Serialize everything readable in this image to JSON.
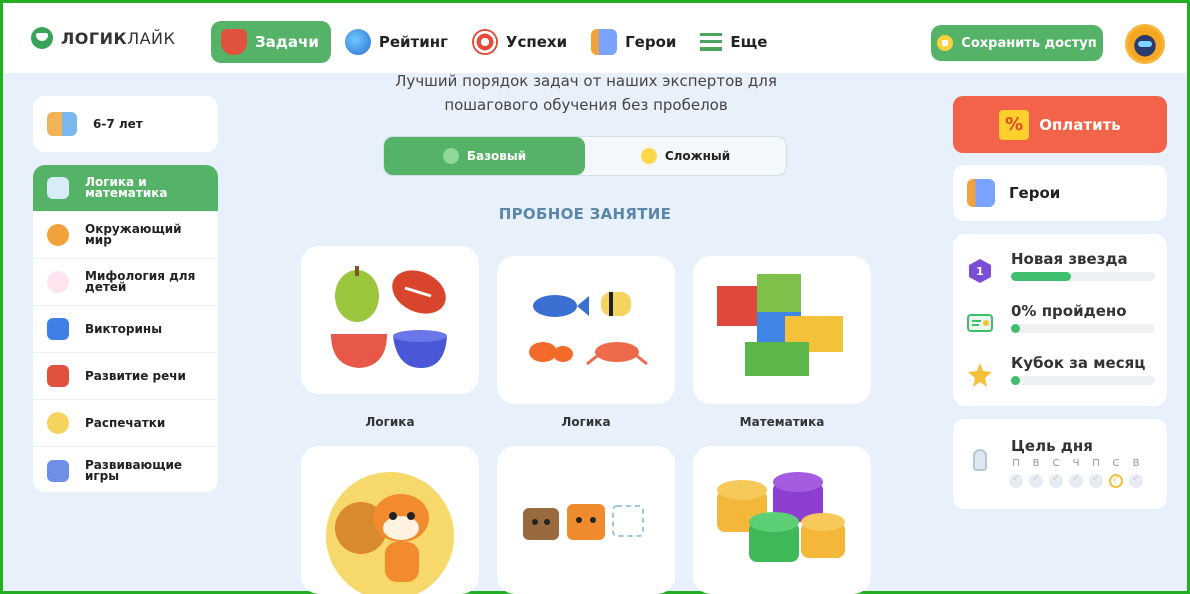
{
  "header": {
    "logo_bold": "ЛОГИК",
    "logo_light": "ЛАЙК",
    "nav": [
      {
        "label": "Задачи",
        "icon": "graduation-cap-icon"
      },
      {
        "label": "Рейтинг",
        "icon": "globe-icon"
      },
      {
        "label": "Успехи",
        "icon": "target-icon"
      },
      {
        "label": "Герои",
        "icon": "robot-hero-icon"
      },
      {
        "label": "Еще",
        "icon": "menu-icon"
      }
    ],
    "save_label": "Сохранить доступ"
  },
  "intro": {
    "line1": "Лучший порядок задач от наших экспертов для",
    "line2": "пошагового обучения без пробелов"
  },
  "level_toggle": {
    "basic": "Базовый",
    "hard": "Сложный",
    "selected": "basic"
  },
  "section_title": "ПРОБНОЕ ЗАНЯТИЕ",
  "age": "6-7 лет",
  "subjects": [
    {
      "line1": "Логика и",
      "line2": "математика"
    },
    {
      "line1": "Окружающий",
      "line2": "мир"
    },
    {
      "line1": "Мифология для",
      "line2": "детей"
    },
    {
      "line1": "Викторины",
      "line2": ""
    },
    {
      "line1": "Развитие речи",
      "line2": ""
    },
    {
      "line1": "Распечатки",
      "line2": ""
    },
    {
      "line1": "Развивающие",
      "line2": "игры"
    }
  ],
  "cards": [
    {
      "label": "Логика",
      "image": "fruits-and-cups"
    },
    {
      "label": "Логика",
      "image": "fish-and-crab"
    },
    {
      "label": "Математика",
      "image": "lego-bricks"
    },
    {
      "label": "",
      "image": "squirrel"
    },
    {
      "label": "",
      "image": "animal-cubes"
    },
    {
      "label": "",
      "image": "cylinder-blocks"
    }
  ],
  "right": {
    "pay_label": "Оплатить",
    "pay_icon_text": "%",
    "heroes_label": "Герои",
    "progress": [
      {
        "title": "Новая звезда",
        "fraction": 0.42,
        "color": "#3fbf6e",
        "icon": "hexagon-badge-icon",
        "badge": "1"
      },
      {
        "title": "0% пройдено",
        "fraction": 0.0,
        "color": "#3fbf6e",
        "icon": "certificate-icon"
      },
      {
        "title": "Кубок за месяц",
        "fraction": 0.0,
        "color": "#3fbf6e",
        "icon": "trophy-icon"
      }
    ],
    "goal_title": "Цель дня",
    "days": [
      "П",
      "В",
      "С",
      "Ч",
      "П",
      "С",
      "В"
    ],
    "today_index": 5
  }
}
